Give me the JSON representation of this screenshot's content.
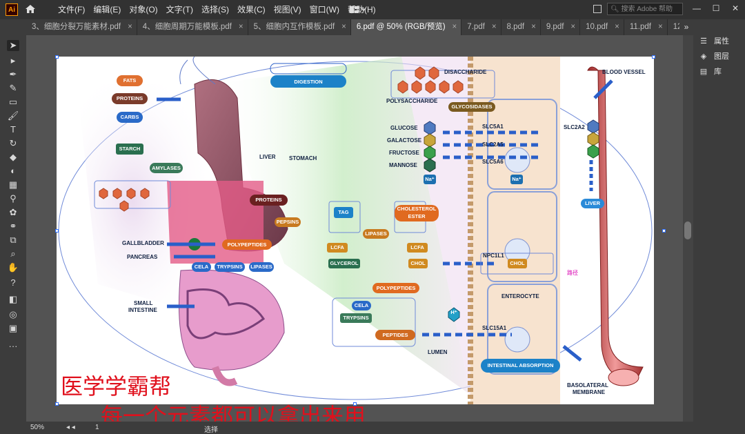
{
  "app": {
    "logo": "Ai",
    "home_icon": "home-icon"
  },
  "menu": [
    "文件(F)",
    "编辑(E)",
    "对象(O)",
    "文字(T)",
    "选择(S)",
    "效果(C)",
    "视图(V)",
    "窗口(W)",
    "帮助(H)"
  ],
  "search": {
    "placeholder": "搜索 Adobe 帮助"
  },
  "window_controls": [
    "—",
    "☐",
    "✕"
  ],
  "tabs": [
    {
      "label": "3、细胞分裂万能素材.pdf",
      "active": false
    },
    {
      "label": "4、细胞周期万能模板.pdf",
      "active": false
    },
    {
      "label": "5、细胞内互作模板.pdf",
      "active": false
    },
    {
      "label": "6.pdf @ 50% (RGB/预览)",
      "active": true
    },
    {
      "label": "7.pdf",
      "active": false
    },
    {
      "label": "8.pdf",
      "active": false
    },
    {
      "label": "9.pdf",
      "active": false
    },
    {
      "label": "10.pdf",
      "active": false
    },
    {
      "label": "11.pdf",
      "active": false
    },
    {
      "label": "12.p",
      "active": false
    }
  ],
  "tab_close": "×",
  "tab_more": "»",
  "panels": [
    {
      "label": "属性",
      "icon": "properties-icon"
    },
    {
      "label": "图层",
      "icon": "layers-icon"
    },
    {
      "label": "库",
      "icon": "library-icon"
    }
  ],
  "status": {
    "zoom": "50%",
    "page": "1",
    "tool": "选择"
  },
  "diagram": {
    "digestion": "DIGESTION",
    "nutrients": [
      "FATS",
      "PROTEINS",
      "CARBS"
    ],
    "starch": "STARCH",
    "amylases": "AMYLASES",
    "liver": "LIVER",
    "stomach": "STOMACH",
    "proteins": "PROTEINS",
    "pepsins": "PEPSINS",
    "polypeptides": "POLYPEPTIDES",
    "gallbladder": "GALLBLADDER",
    "pancreas": "PANCREAS",
    "cela": "CELA",
    "trypsins": "TRYPSINS",
    "lipases_short": "LIPASES",
    "small_intestine_1": "SMALL",
    "small_intestine_2": "INTESTINE",
    "disaccharide": "DISACCHARIDE",
    "polysaccharide": "POLYSACCHARIDE",
    "glycosidases": "GLYCOSIDASES",
    "sugars": [
      "GLUCOSE",
      "GALACTOSE",
      "FRUCTOSE",
      "MANNOSE"
    ],
    "na": "Na⁺",
    "slc5a1": "SLC5A1",
    "slc2a5": "SLC2A5",
    "slc5a": "SLC5A6",
    "slc2a2": "SLC2A2",
    "blood_vessel": "BLOOD VESSEL",
    "liver2": "LIVER",
    "tag": "TAG",
    "cholesterol_1": "CHOLESTEROL",
    "cholesterol_2": "ESTER",
    "lipases": "LIPASES",
    "lcfa": "LCFA",
    "glycerol": "GLYCEROL",
    "chol": "CHOL",
    "npc1l1": "NPC1L1",
    "pathway_cn": "路径",
    "polypeptides2": "POLYPEPTIDES",
    "cela2": "CELA",
    "trypsins2": "TRYPSINS",
    "peptides": "PEPTIDES",
    "h": "H⁺",
    "enterocyte": "ENTEROCYTE",
    "slc15a1": "SLC15A1",
    "lumen": "LUMEN",
    "intestinal_absorption": "INTESTINAL ABSORPTION",
    "basolateral_1": "BASOLATERAL",
    "basolateral_2": "MEMBRANE"
  },
  "watermark": {
    "line1": "医学学霸帮",
    "line2": "每一个元素都可以拿出来用"
  }
}
